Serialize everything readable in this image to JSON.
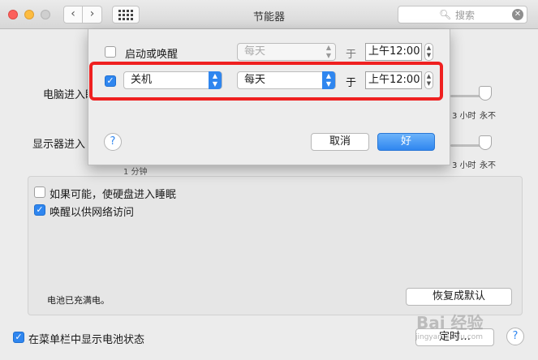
{
  "window": {
    "title": "节能器"
  },
  "nav": {
    "back": "‹",
    "forward": "›"
  },
  "search": {
    "placeholder": "搜索",
    "icon": "magnifier-icon"
  },
  "background": {
    "computer_sleep_label": "电脑进入睡",
    "display_sleep_label": "显示器进入",
    "slider_ticks": {
      "three_hours": "3 小时",
      "never": "永不"
    },
    "partial_text": "1 分钟",
    "option_hard_disk": {
      "label": "如果可能，使硬盘进入睡眠",
      "checked": false
    },
    "option_wake_network": {
      "label": "唤醒以供网络访问",
      "checked": true
    },
    "battery_status": "电池已充满电。",
    "restore_defaults_button": "恢复成默认",
    "show_battery_status": {
      "label": "在菜单栏中显示电池状态",
      "checked": true
    },
    "schedule_button": "定时…",
    "help": "?"
  },
  "schedule_sheet": {
    "row1": {
      "checked": false,
      "action": "启动或唤醒",
      "frequency": "每天",
      "at": "于",
      "time": "上午12:00"
    },
    "row2": {
      "checked": true,
      "action": "关机",
      "frequency": "每天",
      "at": "于",
      "time": "上午12:00"
    },
    "help": "?",
    "cancel_button": "取消",
    "ok_button": "好"
  },
  "watermark": {
    "text": "Bai 经验",
    "sub": "jingyan.baidu.com"
  },
  "colors": {
    "accent": "#2f86ef",
    "highlight": "#ef2020"
  }
}
